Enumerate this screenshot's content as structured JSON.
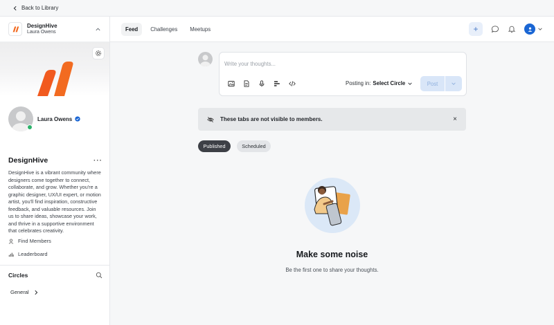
{
  "topbar": {
    "back_label": "Back to Library"
  },
  "sidebar": {
    "community_name": "DesignHive",
    "owner_name": "Laura Owens",
    "profile_name": "Laura Owens",
    "community_title": "DesignHive",
    "description": "DesignHive is a vibrant community where designers come together to connect, collaborate, and grow. Whether you're a graphic designer, UX/UI expert, or motion artist, you'll find inspiration, constructive feedback, and valuable resources. Join us to share ideas, showcase your work, and thrive in a supportive environment that celebrates creativity.",
    "links": [
      {
        "label": "Find Members",
        "icon": "person-icon"
      },
      {
        "label": "Leaderboard",
        "icon": "bar-chart-icon"
      }
    ],
    "circles_title": "Circles",
    "circles": [
      {
        "label": "General"
      }
    ]
  },
  "header": {
    "tabs": [
      {
        "label": "Feed",
        "active": true
      },
      {
        "label": "Challenges",
        "active": false
      },
      {
        "label": "Meetups",
        "active": false
      }
    ],
    "plus_label": "+"
  },
  "composer": {
    "placeholder": "Write your thoughts...",
    "posting_prefix": "Posting in:",
    "posting_value": "Select Circle",
    "post_label": "Post"
  },
  "notice": {
    "text": "These tabs are not visible to members.",
    "close": "×"
  },
  "filters": [
    {
      "label": "Published",
      "active": true
    },
    {
      "label": "Scheduled",
      "active": false
    }
  ],
  "empty_state": {
    "title": "Make some noise",
    "subtitle": "Be the first one to share your thoughts."
  },
  "colors": {
    "accent": "#1a66d4",
    "brand_orange": "#f26b21",
    "online": "#2cb36b"
  }
}
